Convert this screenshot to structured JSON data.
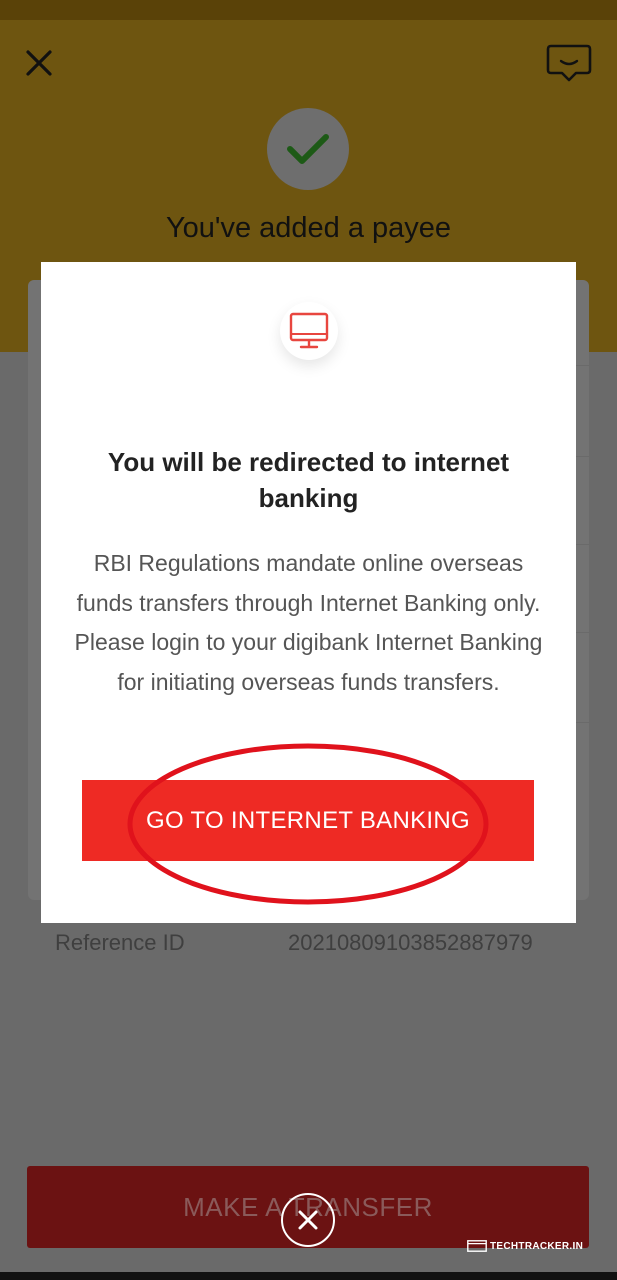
{
  "header": {
    "title": "You've added a payee"
  },
  "details": {
    "reference_label": "Reference ID",
    "reference_value": "20210809103852887979"
  },
  "footer": {
    "make_transfer_label": "MAKE A TRANSFER"
  },
  "modal": {
    "icon": "monitor-icon",
    "title": "You will be redirected to internet banking",
    "body": "RBI Regulations mandate online overseas funds transfers through Internet Banking only. Please login to your digibank Internet Banking for initiating overseas funds transfers.",
    "button_label": "GO TO INTERNET BANKING"
  },
  "watermark": {
    "text": "TECHTRACKER.IN"
  },
  "colors": {
    "accent_red": "#ee2a24",
    "header_gold": "#e0a21e",
    "annotation_red": "#e0121c"
  }
}
